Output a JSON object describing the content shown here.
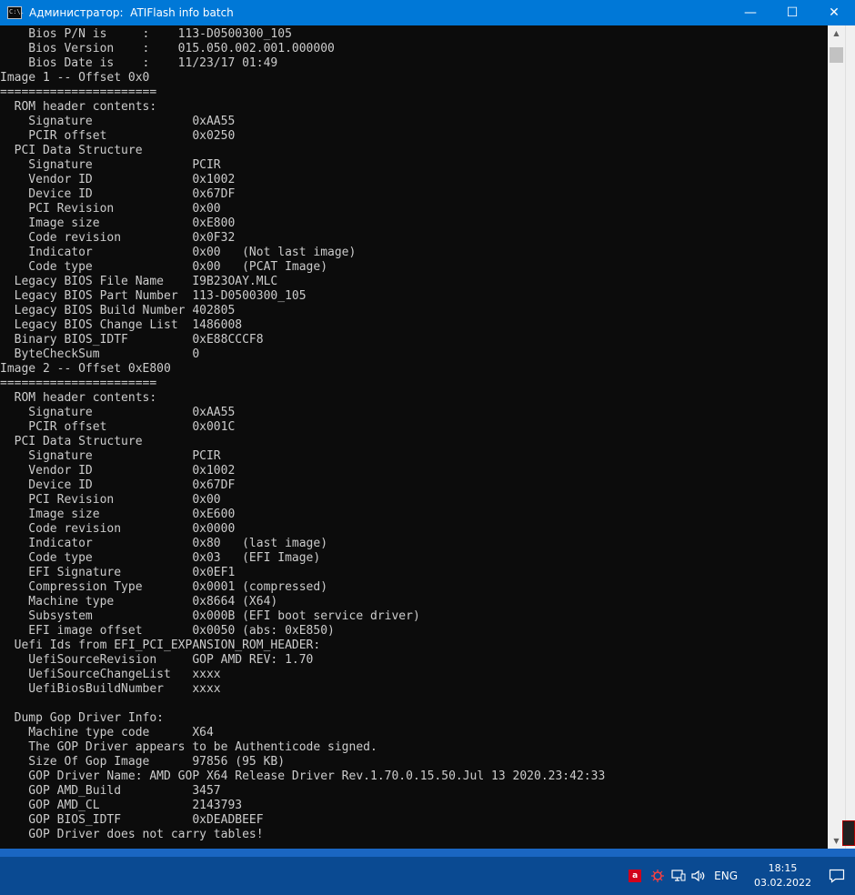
{
  "window": {
    "title": "Администратор:  ATIFlash info batch",
    "icon_text": "C:\\."
  },
  "controls": {
    "minimize": "—",
    "maximize": "☐",
    "close": "✕"
  },
  "console": {
    "lines": [
      "    Bios P/N is     :    113-D0500300_105",
      "    Bios Version    :    015.050.002.001.000000",
      "    Bios Date is    :    11/23/17 01:49",
      "Image 1 -- Offset 0x0",
      "======================",
      "  ROM header contents:",
      "    Signature              0xAA55",
      "    PCIR offset            0x0250",
      "  PCI Data Structure",
      "    Signature              PCIR",
      "    Vendor ID              0x1002",
      "    Device ID              0x67DF",
      "    PCI Revision           0x00",
      "    Image size             0xE800",
      "    Code revision          0x0F32",
      "    Indicator              0x00   (Not last image)",
      "    Code type              0x00   (PCAT Image)",
      "  Legacy BIOS File Name    I9B23OAY.MLC",
      "  Legacy BIOS Part Number  113-D0500300_105",
      "  Legacy BIOS Build Number 402805",
      "  Legacy BIOS Change List  1486008",
      "  Binary BIOS_IDTF         0xE88CCCF8",
      "  ByteCheckSum             0",
      "Image 2 -- Offset 0xE800",
      "======================",
      "  ROM header contents:",
      "    Signature              0xAA55",
      "    PCIR offset            0x001C",
      "  PCI Data Structure",
      "    Signature              PCIR",
      "    Vendor ID              0x1002",
      "    Device ID              0x67DF",
      "    PCI Revision           0x00",
      "    Image size             0xE600",
      "    Code revision          0x0000",
      "    Indicator              0x80   (last image)",
      "    Code type              0x03   (EFI Image)",
      "    EFI Signature          0x0EF1",
      "    Compression Type       0x0001 (compressed)",
      "    Machine type           0x8664 (X64)",
      "    Subsystem              0x000B (EFI boot service driver)",
      "    EFI image offset       0x0050 (abs: 0xE850)",
      "  Uefi Ids from EFI_PCI_EXPANSION_ROM_HEADER:",
      "    UefiSourceRevision     GOP AMD REV: 1.70",
      "    UefiSourceChangeList   xxxx",
      "    UefiBiosBuildNumber    xxxx",
      "",
      "  Dump Gop Driver Info:",
      "    Machine type code      X64",
      "    The GOP Driver appears to be Authenticode signed.",
      "    Size Of Gop Image      97856 (95 KB)",
      "    GOP Driver Name: AMD GOP X64 Release Driver Rev.1.70.0.15.50.Jul 13 2020.23:42:33",
      "    GOP AMD_Build          3457",
      "    GOP AMD_CL             2143793",
      "    GOP BIOS_IDTF          0xDEADBEEF",
      "    GOP Driver does not carry tables!"
    ]
  },
  "scrollbar": {
    "up_arrow": "▲",
    "down_arrow": "▼"
  },
  "taskbar": {
    "amd_icon": "a",
    "language": "ENG",
    "time": "18:15",
    "date": "03.02.2022"
  },
  "icons": {
    "app": "console-icon",
    "tray": [
      "amd-icon",
      "virus-icon",
      "network-icon",
      "volume-icon",
      "notification-icon"
    ]
  },
  "colors": {
    "titlebar": "#0078d7",
    "console_bg": "#0c0c0c",
    "console_text": "#cccccc",
    "taskbar": "#0a4a92"
  }
}
